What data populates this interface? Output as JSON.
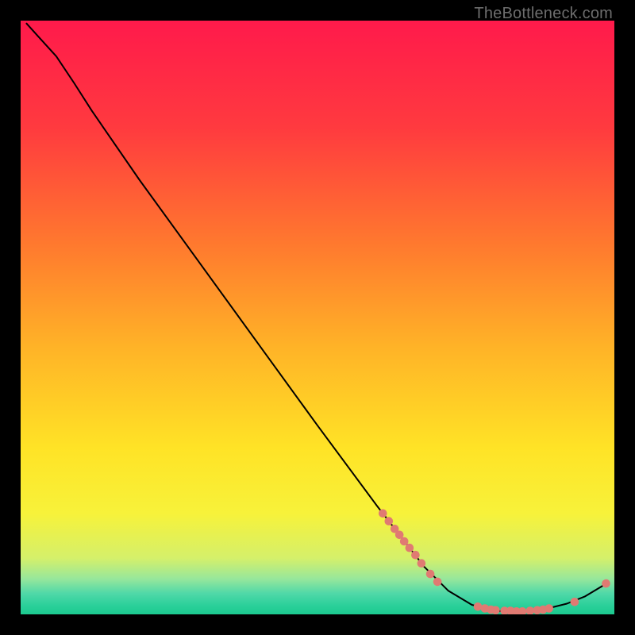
{
  "watermark": "TheBottleneck.com",
  "chart_data": {
    "type": "line",
    "title": "",
    "xlabel": "",
    "ylabel": "",
    "x_range": [
      0,
      100
    ],
    "y_range": [
      0,
      100
    ],
    "background_gradient": {
      "stops": [
        {
          "offset": 0.0,
          "color": "#ff1a4b"
        },
        {
          "offset": 0.18,
          "color": "#ff3a3f"
        },
        {
          "offset": 0.38,
          "color": "#ff7a2e"
        },
        {
          "offset": 0.55,
          "color": "#ffb327"
        },
        {
          "offset": 0.72,
          "color": "#ffe326"
        },
        {
          "offset": 0.83,
          "color": "#f7f23a"
        },
        {
          "offset": 0.905,
          "color": "#d5f06a"
        },
        {
          "offset": 0.94,
          "color": "#97e79b"
        },
        {
          "offset": 0.965,
          "color": "#4fd8a8"
        },
        {
          "offset": 0.985,
          "color": "#2bd09a"
        },
        {
          "offset": 1.0,
          "color": "#1cc98f"
        }
      ]
    },
    "series": [
      {
        "name": "bottleneck-curve",
        "color": "#000000",
        "type": "line",
        "points": [
          {
            "x": 1.0,
            "y": 99.5
          },
          {
            "x": 3.0,
            "y": 97.3
          },
          {
            "x": 6.0,
            "y": 94.0
          },
          {
            "x": 9.0,
            "y": 89.5
          },
          {
            "x": 12.0,
            "y": 84.8
          },
          {
            "x": 20.0,
            "y": 73.2
          },
          {
            "x": 30.0,
            "y": 59.4
          },
          {
            "x": 40.0,
            "y": 45.6
          },
          {
            "x": 50.0,
            "y": 31.8
          },
          {
            "x": 60.0,
            "y": 18.3
          },
          {
            "x": 68.0,
            "y": 8.0
          },
          {
            "x": 72.0,
            "y": 4.0
          },
          {
            "x": 76.0,
            "y": 1.6
          },
          {
            "x": 80.0,
            "y": 0.6
          },
          {
            "x": 84.0,
            "y": 0.4
          },
          {
            "x": 88.0,
            "y": 0.8
          },
          {
            "x": 92.0,
            "y": 1.8
          },
          {
            "x": 95.0,
            "y": 3.0
          },
          {
            "x": 98.5,
            "y": 5.1
          }
        ]
      },
      {
        "name": "highlighted-points",
        "color": "#e07a72",
        "type": "scatter",
        "points": [
          {
            "x": 61.0,
            "y": 17.0
          },
          {
            "x": 62.0,
            "y": 15.7
          },
          {
            "x": 63.0,
            "y": 14.4
          },
          {
            "x": 63.8,
            "y": 13.4
          },
          {
            "x": 64.6,
            "y": 12.3
          },
          {
            "x": 65.5,
            "y": 11.2
          },
          {
            "x": 66.5,
            "y": 10.0
          },
          {
            "x": 67.5,
            "y": 8.6
          },
          {
            "x": 69.0,
            "y": 6.8
          },
          {
            "x": 70.2,
            "y": 5.5
          },
          {
            "x": 77.0,
            "y": 1.3
          },
          {
            "x": 78.2,
            "y": 1.0
          },
          {
            "x": 79.2,
            "y": 0.8
          },
          {
            "x": 80.0,
            "y": 0.7
          },
          {
            "x": 81.5,
            "y": 0.6
          },
          {
            "x": 82.5,
            "y": 0.6
          },
          {
            "x": 83.5,
            "y": 0.5
          },
          {
            "x": 84.5,
            "y": 0.5
          },
          {
            "x": 85.8,
            "y": 0.6
          },
          {
            "x": 87.0,
            "y": 0.7
          },
          {
            "x": 88.0,
            "y": 0.8
          },
          {
            "x": 89.0,
            "y": 1.0
          },
          {
            "x": 93.3,
            "y": 2.1
          },
          {
            "x": 98.6,
            "y": 5.2
          }
        ]
      }
    ]
  }
}
